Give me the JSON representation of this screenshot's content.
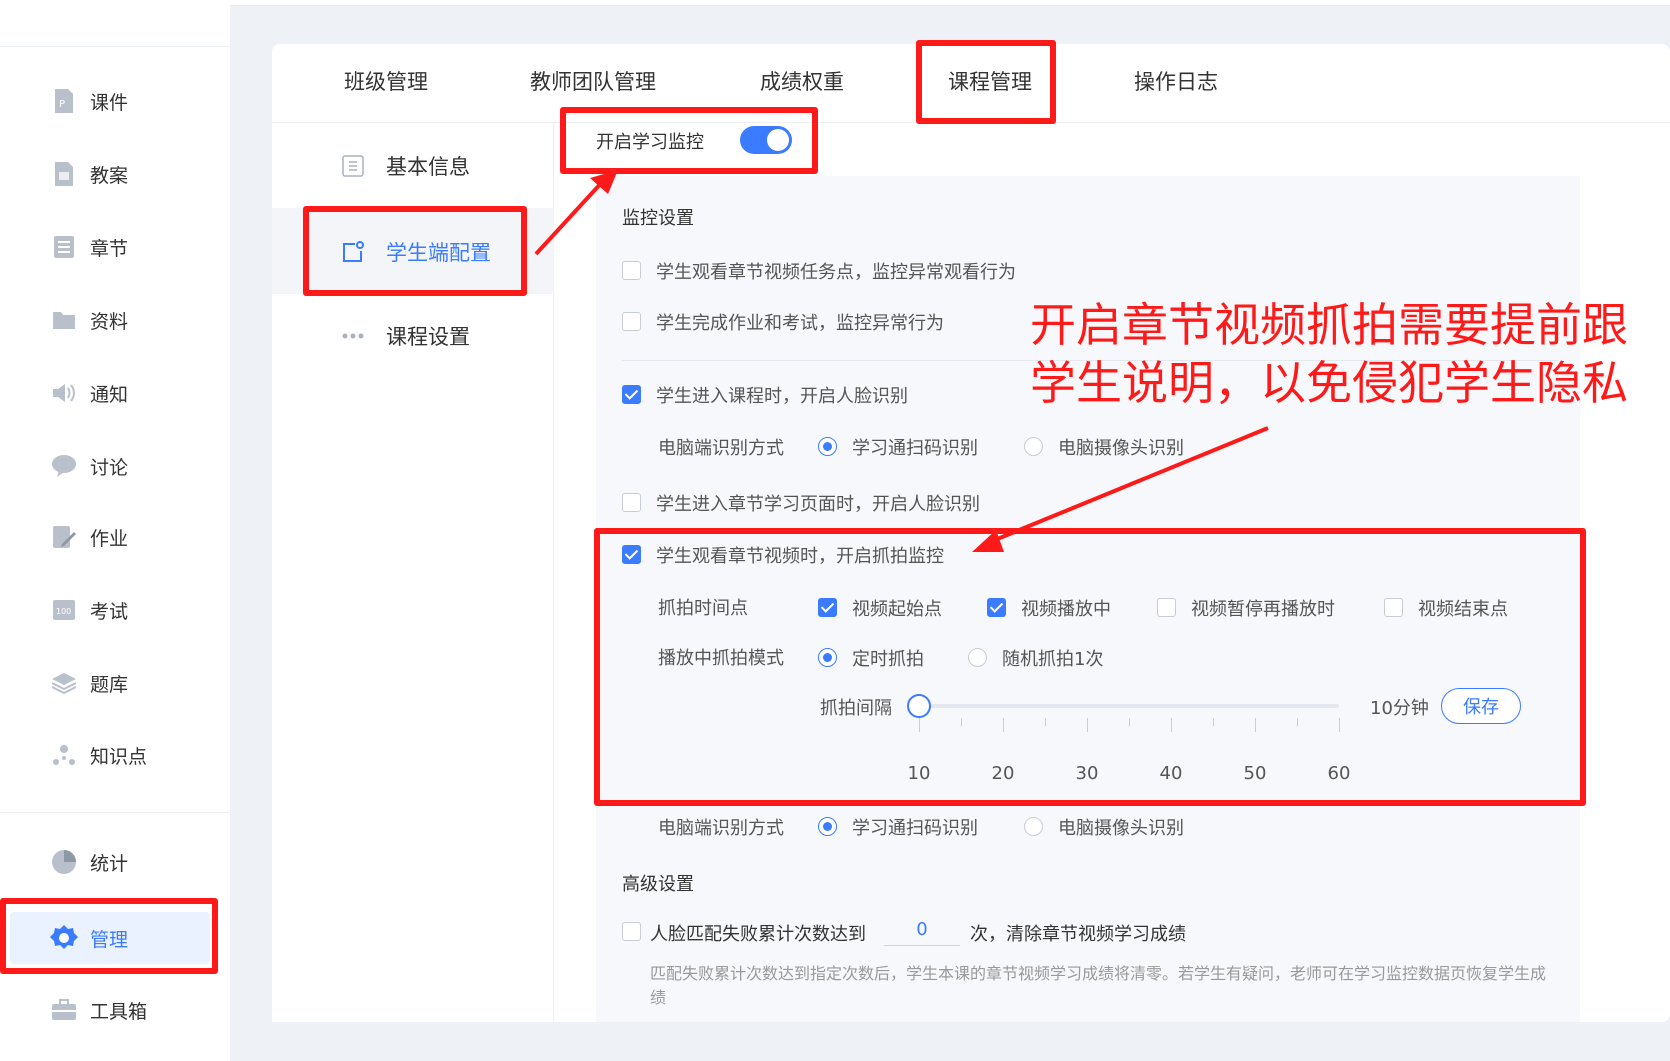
{
  "sidebar": {
    "items": [
      {
        "label": "课件",
        "icon": "courseware-icon"
      },
      {
        "label": "教案",
        "icon": "lesson-plan-icon"
      },
      {
        "label": "章节",
        "icon": "chapter-icon"
      },
      {
        "label": "资料",
        "icon": "folder-icon"
      },
      {
        "label": "通知",
        "icon": "speaker-icon"
      },
      {
        "label": "讨论",
        "icon": "chat-bubble-icon"
      },
      {
        "label": "作业",
        "icon": "homework-icon"
      },
      {
        "label": "考试",
        "icon": "exam-icon"
      },
      {
        "label": "题库",
        "icon": "question-bank-icon"
      },
      {
        "label": "知识点",
        "icon": "knowledge-node-icon"
      },
      {
        "label": "统计",
        "icon": "pie-chart-icon"
      },
      {
        "label": "管理",
        "icon": "gear-icon",
        "active": true
      },
      {
        "label": "工具箱",
        "icon": "toolbox-icon"
      }
    ]
  },
  "tabs": [
    {
      "label": "班级管理"
    },
    {
      "label": "教师团队管理"
    },
    {
      "label": "成绩权重"
    },
    {
      "label": "课程管理",
      "active": true
    },
    {
      "label": "操作日志"
    }
  ],
  "subnav": [
    {
      "label": "基本信息",
      "icon": "document-icon"
    },
    {
      "label": "学生端配置",
      "icon": "client-config-icon",
      "active": true
    },
    {
      "label": "课程设置",
      "icon": "more-dots-icon"
    }
  ],
  "monitor": {
    "toggle_label": "开启学习监控",
    "toggle_on": true,
    "settings_title": "监控设置",
    "opt_video_abnormal": "学生观看章节视频任务点，监控异常观看行为",
    "opt_video_abnormal_checked": false,
    "opt_homework_abnormal": "学生完成作业和考试，监控异常行为",
    "opt_homework_abnormal_checked": false,
    "opt_face_enter_course": "学生进入课程时，开启人脸识别",
    "opt_face_enter_course_checked": true,
    "pc_method_label": "电脑端识别方式",
    "pc_method_scan": "学习通扫码识别",
    "pc_method_camera": "电脑摄像头识别",
    "pc_method_selected": "学习通扫码识别",
    "opt_face_enter_chapter": "学生进入章节学习页面时，开启人脸识别",
    "opt_face_enter_chapter_checked": false,
    "opt_snapshot": "学生观看章节视频时，开启抓拍监控",
    "opt_snapshot_checked": true,
    "snapshot_time_label": "抓拍时间点",
    "snapshot_times": [
      {
        "label": "视频起始点",
        "checked": true
      },
      {
        "label": "视频播放中",
        "checked": true
      },
      {
        "label": "视频暂停再播放时",
        "checked": false
      },
      {
        "label": "视频结束点",
        "checked": false
      }
    ],
    "play_mode_label": "播放中抓拍模式",
    "play_mode_timed": "定时抓拍",
    "play_mode_random": "随机抓拍1次",
    "play_mode_selected": "定时抓拍",
    "interval_label": "抓拍间隔",
    "interval_value": "10分钟",
    "interval_minutes": 10,
    "interval_ticks": [
      "10",
      "20",
      "30",
      "40",
      "50",
      "60"
    ],
    "save_label": "保存",
    "pc_method_label_2": "电脑端识别方式",
    "pc_method_scan_2": "学习通扫码识别",
    "pc_method_camera_2": "电脑摄像头识别",
    "advanced_title": "高级设置",
    "adv_prefix": "人脸匹配失败累计次数达到",
    "adv_count": "0",
    "adv_suffix": "次，清除章节视频学习成绩",
    "adv_checked": false,
    "adv_note": "匹配失败累计次数达到指定次数后，学生本课的章节视频学习成绩将清零。若学生有疑问，老师可在学习监控数据页恢复学生成绩"
  },
  "annotation": {
    "text": "开启章节视频抓拍需要提前跟学生说明，以免侵犯学生隐私",
    "color": "#ff1a1a"
  },
  "colors": {
    "accent": "#3a7bff",
    "highlight_red": "#ff1a1a",
    "panel_bg": "#f6f8fb"
  }
}
